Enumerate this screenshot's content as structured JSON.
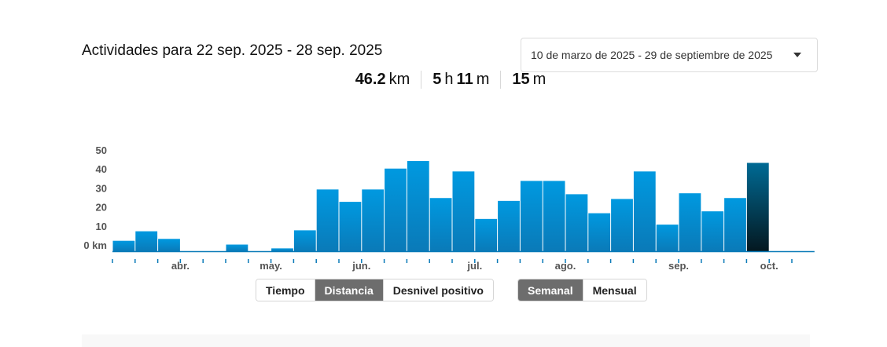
{
  "header": {
    "title": "Actividades para 22 sep. 2025 - 28 sep. 2025",
    "date_range": "10 de marzo de 2025 - 29 de septiembre de 2025"
  },
  "stats": {
    "distance_value": "46.2",
    "distance_unit": "km",
    "hours_value": "5",
    "hours_unit": "h",
    "minutes_value": "11",
    "minutes_unit": "m",
    "elevation_value": "15",
    "elevation_unit": "m"
  },
  "metric_tabs": [
    {
      "label": "Tiempo",
      "active": false
    },
    {
      "label": "Distancia",
      "active": true
    },
    {
      "label": "Desnivel positivo",
      "active": false
    }
  ],
  "period_tabs": [
    {
      "label": "Semanal",
      "active": true
    },
    {
      "label": "Mensual",
      "active": false
    }
  ],
  "colors": {
    "bar_top": "#0099e0",
    "bar_bottom": "#0a7ab8",
    "selected_top": "#006a94",
    "selected_bottom": "#041820",
    "axis": "#0a7ab8"
  },
  "chart_data": {
    "type": "bar",
    "unit": "km",
    "ylim": [
      0,
      50
    ],
    "y_ticks": [
      {
        "value": 0,
        "label": "0 km"
      },
      {
        "value": 10,
        "label": "10"
      },
      {
        "value": 20,
        "label": "20"
      },
      {
        "value": 30,
        "label": "30"
      },
      {
        "value": 40,
        "label": "40"
      },
      {
        "value": 50,
        "label": "50"
      }
    ],
    "grid": false,
    "values": [
      5.5,
      10.5,
      6.5,
      0,
      0,
      3.5,
      0,
      1.5,
      11,
      32.5,
      26,
      32.5,
      43.5,
      47.5,
      28,
      42,
      17,
      26.5,
      37,
      37,
      30,
      20,
      27.5,
      42,
      14,
      30.5,
      21,
      28,
      46.5
    ],
    "selected_index": 28,
    "month_labels": [
      {
        "label": "abr.",
        "week_index": 3
      },
      {
        "label": "may.",
        "week_index": 7
      },
      {
        "label": "jun.",
        "week_index": 11
      },
      {
        "label": "jul.",
        "week_index": 16
      },
      {
        "label": "ago.",
        "week_index": 20
      },
      {
        "label": "sep.",
        "week_index": 25
      },
      {
        "label": "oct.",
        "week_index": 29
      }
    ]
  }
}
